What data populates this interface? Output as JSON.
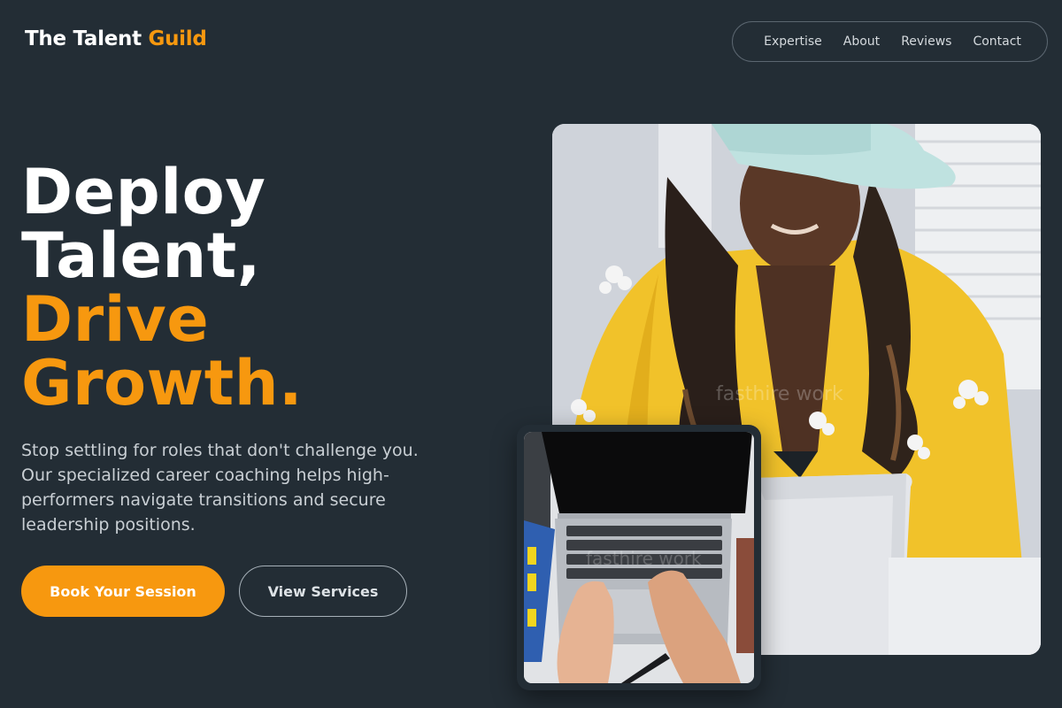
{
  "brand": {
    "name_part1": "The Talent",
    "name_part2": "Guild",
    "accent_color": "#f7980f",
    "background_color": "#232d35"
  },
  "nav": {
    "items": [
      {
        "label": "Expertise"
      },
      {
        "label": "About"
      },
      {
        "label": "Reviews"
      },
      {
        "label": "Contact"
      }
    ]
  },
  "hero": {
    "headline_lines": [
      "Deploy",
      "Talent,",
      "Drive",
      "Growth."
    ],
    "subtext": "Stop settling for roles that don't challenge you. Our specialized career coaching helps high-performers navigate transitions and secure leadership positions.",
    "primary_cta": "Book Your Session",
    "secondary_cta": "View Services"
  },
  "images": {
    "main_watermark": "fasthire work",
    "inset_watermark": "fasthire work"
  }
}
